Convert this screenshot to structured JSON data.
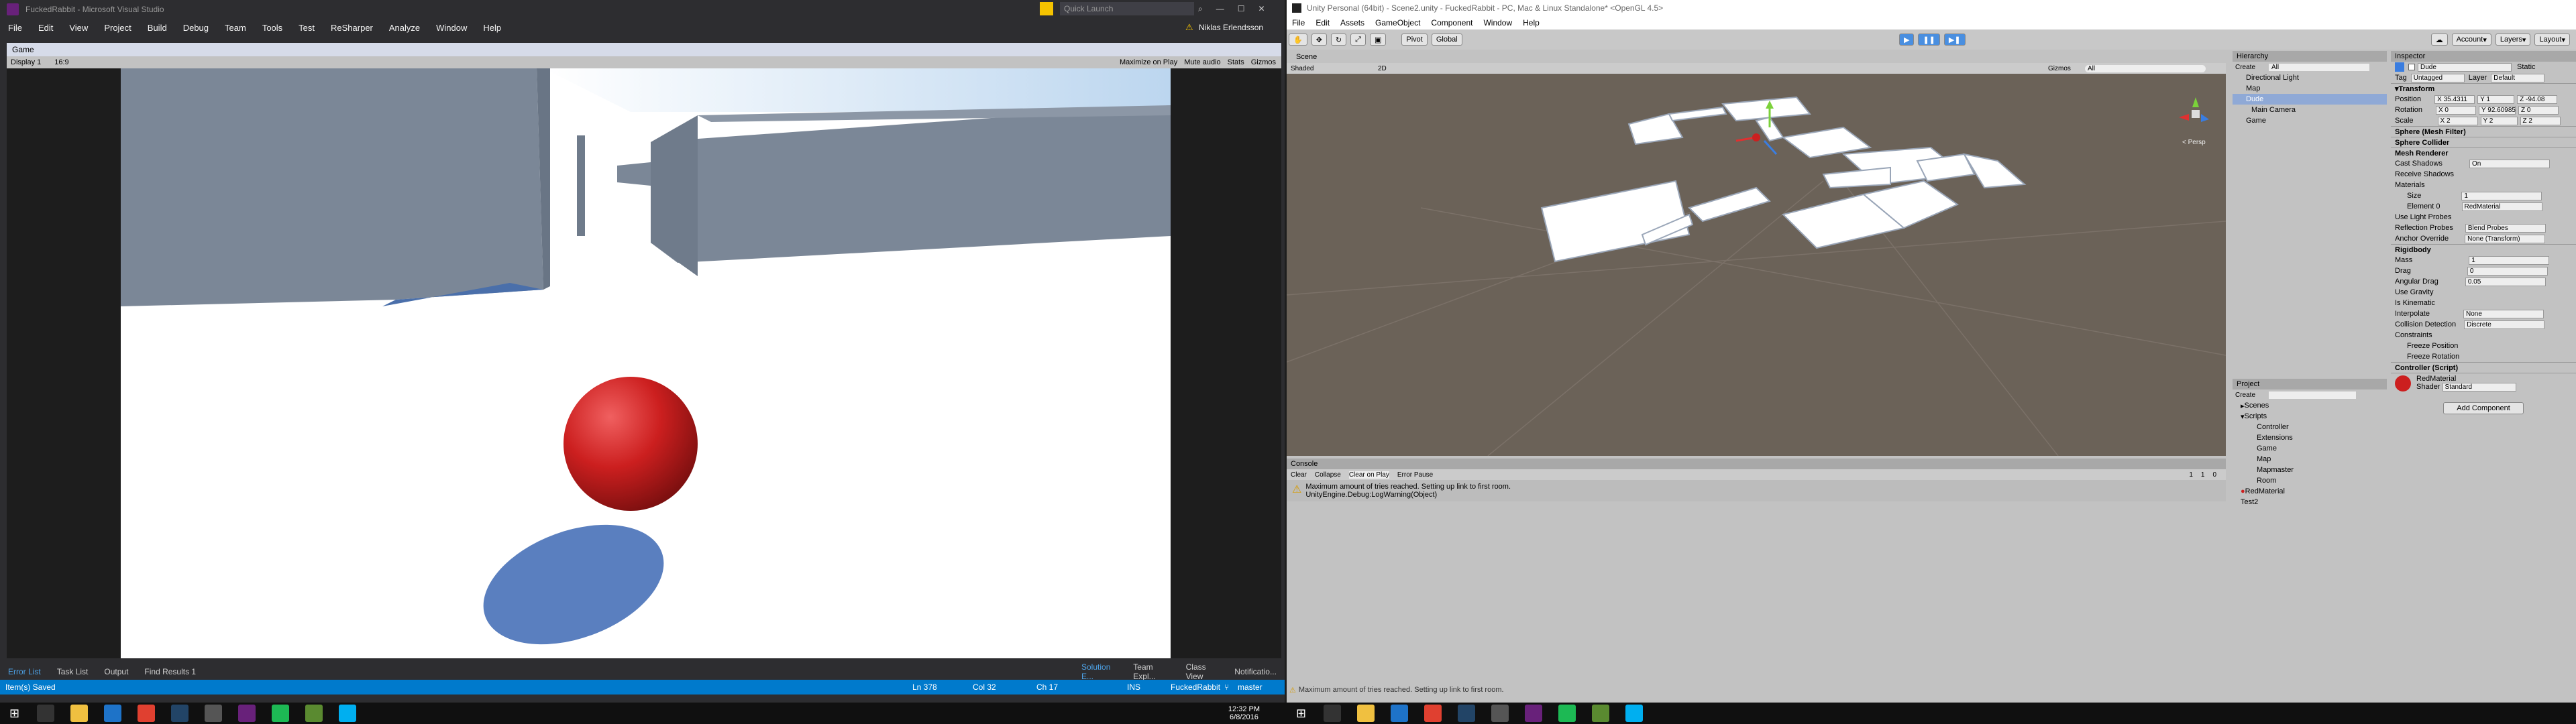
{
  "vs": {
    "title": "FuckedRabbit - Microsoft Visual Studio",
    "quick_launch": "Quick Launch",
    "user": "Niklas Erlendsson",
    "menu": [
      "File",
      "Edit",
      "View",
      "Project",
      "Build",
      "Debug",
      "Team",
      "Tools",
      "Test",
      "ReSharper",
      "Analyze",
      "Window",
      "Help"
    ],
    "doc_tab": "Game",
    "game_toolbar": {
      "display": "Display 1",
      "aspect": "16:9",
      "buttons": [
        "Maximize on Play",
        "Mute audio",
        "Stats",
        "Gizmos"
      ]
    },
    "bottom_tabs": [
      "Error List",
      "Task List",
      "Output",
      "Find Results 1"
    ],
    "bottom_right_tabs": [
      "Solution E...",
      "Team Expl...",
      "Class View",
      "Notificatio..."
    ],
    "status": {
      "left": "Item(s) Saved",
      "ln": "Ln 378",
      "col": "Col 32",
      "ch": "Ch 17",
      "ins": "INS",
      "project": "FuckedRabbit",
      "branch": "master"
    }
  },
  "unity": {
    "title": "Unity Personal (64bit) - Scene2.unity - FuckedRabbit - PC, Mac & Linux Standalone* <OpenGL 4.5>",
    "menu": [
      "File",
      "Edit",
      "Assets",
      "GameObject",
      "Component",
      "Window",
      "Help"
    ],
    "toolbar": {
      "pivot": "Pivot",
      "global": "Global",
      "account": "Account",
      "layers": "Layers",
      "layout": "Layout"
    },
    "scene_tab": "Scene",
    "scene_bar": {
      "shading": "Shaded",
      "mode": "2D",
      "gizmos": "Gizmos",
      "search": "All"
    },
    "persp": "< Persp",
    "console": {
      "tab": "Console",
      "buttons": [
        "Clear",
        "Collapse",
        "Clear on Play",
        "Error Pause"
      ],
      "counts": [
        "1",
        "1",
        "0"
      ],
      "message": "Maximum amount of tries reached. Setting up link to first room.",
      "stack": "UnityEngine.Debug:LogWarning(Object)"
    },
    "hierarchy": {
      "tab": "Hierarchy",
      "create": "Create",
      "search": "All",
      "items": [
        "Directional Light",
        "Map",
        "Dude",
        "Main Camera",
        "Game"
      ]
    },
    "project": {
      "tab": "Project",
      "create": "Create",
      "items": [
        "Scenes",
        "Scripts",
        "Controller",
        "Extensions",
        "Game",
        "Map",
        "Mapmaster",
        "Room",
        "RedMaterial",
        "Test2"
      ]
    },
    "inspector": {
      "tab": "Inspector",
      "name": "Dude",
      "static": "Static",
      "tag": "Untagged",
      "layer": "Default",
      "transform": {
        "header": "Transform",
        "position": [
          "X 35.4311",
          "Y 1",
          "Z -94.08"
        ],
        "rotation": [
          "X 0",
          "Y 92.60985",
          "Z 0"
        ],
        "scale": [
          "X 2",
          "Y 2",
          "Z 2"
        ]
      },
      "mesh_filter": "Sphere (Mesh Filter)",
      "sphere_collider": "Sphere Collider",
      "mesh_renderer": {
        "header": "Mesh Renderer",
        "cast_shadows": "On",
        "receive_shadows": "Receive Shadows",
        "materials": "Materials",
        "size": "1",
        "element0": "RedMaterial",
        "light_probes": "Use Light Probes",
        "reflection": "Blend Probes",
        "anchor": "None (Transform)"
      },
      "rigidbody": {
        "header": "Rigidbody",
        "mass": "1",
        "drag": "0",
        "angular_drag": "0.05",
        "use_gravity": "Use Gravity",
        "is_kinematic": "Is Kinematic",
        "interpolate": "None",
        "collision": "Discrete",
        "constraints": "Constraints",
        "freeze_pos": "Freeze Position",
        "freeze_rot": "Freeze Rotation"
      },
      "controller": "Controller (Script)",
      "material": {
        "name": "RedMaterial",
        "shader": "Standard"
      },
      "add_component": "Add Component"
    },
    "status": "Maximum amount of tries reached. Setting up link to first room."
  },
  "taskbar": {
    "time": "12:32 PM",
    "date": "6/8/2016"
  },
  "colors": {
    "vs_blue": "#007acc",
    "sky": "#ffffff",
    "wall": "#7b8797",
    "ball": "#cc1f1f",
    "shadow": "#5a7fbf"
  }
}
